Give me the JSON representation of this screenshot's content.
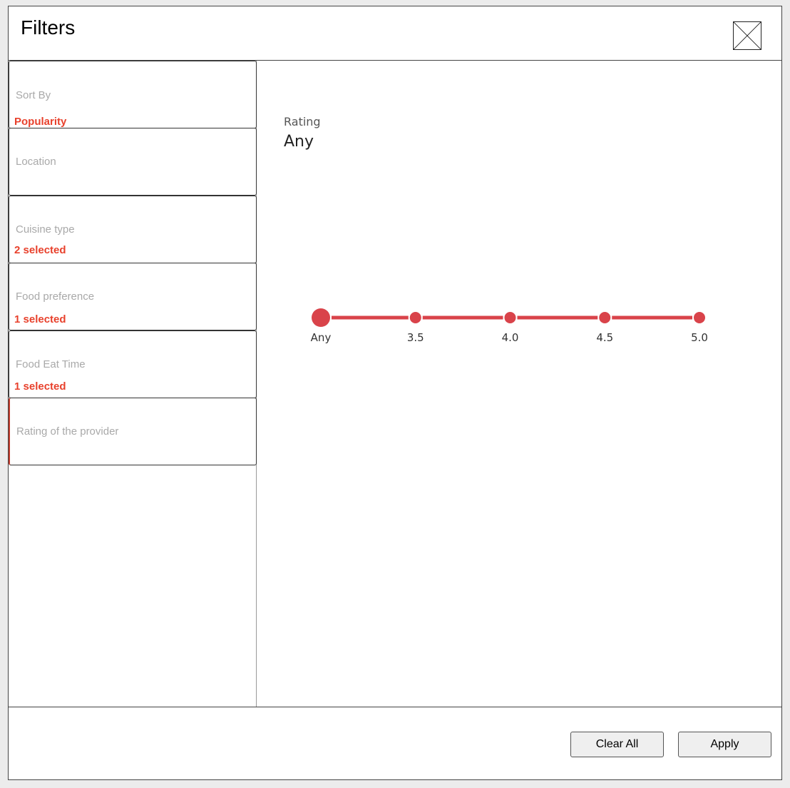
{
  "window": {
    "title": "Filters"
  },
  "sidebar": {
    "items": [
      {
        "label": "Sort By",
        "value": "Popularity"
      },
      {
        "label": "Location",
        "value": ""
      },
      {
        "label": "Cuisine type",
        "value": "2 selected"
      },
      {
        "label": "Food preference",
        "value": "1 selected"
      },
      {
        "label": "Food Eat Time",
        "value": "1 selected"
      },
      {
        "label": "Rating of the provider",
        "value": ""
      }
    ],
    "active_index": 5
  },
  "main": {
    "rating_label": "Rating",
    "rating_value": "Any",
    "slider": {
      "options": [
        "Any",
        "3.5",
        "4.0",
        "4.5",
        "5.0"
      ],
      "selected_index": 0,
      "color": "#d9434a"
    }
  },
  "footer": {
    "clear_label": "Clear All",
    "apply_label": "Apply"
  },
  "icons": {
    "close": "close-icon"
  },
  "colors": {
    "accent": "#e8412c",
    "slider": "#d9434a",
    "muted_label": "#a9a9a9"
  }
}
